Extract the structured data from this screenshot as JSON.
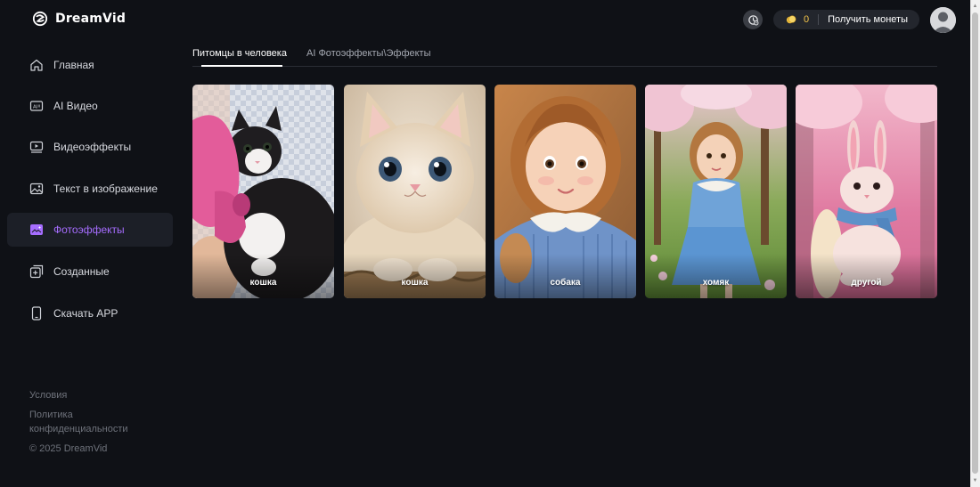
{
  "app": {
    "brand": "DreamVid",
    "accent_color": "#a66dff",
    "background_color": "#0f1116"
  },
  "header": {
    "history_icon": "history-refresh-icon",
    "coins": {
      "count": "0",
      "label": "Получить монеты",
      "icon": "coin-icon"
    },
    "avatar_icon": "user-avatar-icon"
  },
  "sidebar": {
    "items": [
      {
        "label": "Главная",
        "icon": "home-icon",
        "active": false
      },
      {
        "label": "AI Видео",
        "icon": "ai-video-icon",
        "active": false
      },
      {
        "label": "Видеоэффекты",
        "icon": "video-effects-icon",
        "active": false
      },
      {
        "label": "Текст в изображение",
        "icon": "image-icon",
        "active": false
      },
      {
        "label": "Фотоэффекты",
        "icon": "photo-effects-icon",
        "active": true
      },
      {
        "label": "Созданные",
        "icon": "created-icon",
        "active": false
      },
      {
        "label": "Скачать APP",
        "icon": "phone-icon",
        "active": false
      }
    ],
    "footer": {
      "terms": "Условия",
      "privacy": "Политика конфиденциальности",
      "copyright": "© 2025 DreamVid"
    }
  },
  "main": {
    "tabs": [
      {
        "label": "Питомцы в человека",
        "active": true
      },
      {
        "label": "AI Фотоэффекты\\Эффекты",
        "active": false
      }
    ],
    "cards": [
      {
        "label": "кошка"
      },
      {
        "label": "кошка"
      },
      {
        "label": "собака"
      },
      {
        "label": "хомяк"
      },
      {
        "label": "другой"
      }
    ]
  }
}
